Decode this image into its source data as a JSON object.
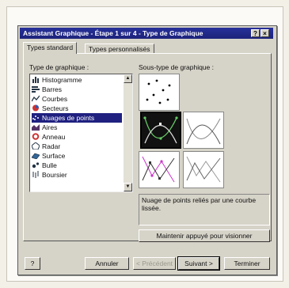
{
  "window": {
    "title": "Assistant Graphique - Étape 1 sur 4 - Type de Graphique",
    "help_glyph": "?",
    "close_glyph": "×"
  },
  "tabs": [
    {
      "label": "Types standard",
      "active": true
    },
    {
      "label": "Types personnalisés",
      "active": false
    }
  ],
  "chart_type": {
    "label": "Type de graphique :",
    "items": [
      {
        "label": "Histogramme",
        "icon": "bar-chart-icon"
      },
      {
        "label": "Barres",
        "icon": "horizontal-bar-icon"
      },
      {
        "label": "Courbes",
        "icon": "line-chart-icon"
      },
      {
        "label": "Secteurs",
        "icon": "pie-chart-icon"
      },
      {
        "label": "Nuages de points",
        "icon": "scatter-chart-icon",
        "selected": true
      },
      {
        "label": "Aires",
        "icon": "area-chart-icon"
      },
      {
        "label": "Anneau",
        "icon": "donut-chart-icon"
      },
      {
        "label": "Radar",
        "icon": "radar-chart-icon"
      },
      {
        "label": "Surface",
        "icon": "surface-chart-icon"
      },
      {
        "label": "Bulle",
        "icon": "bubble-chart-icon"
      },
      {
        "label": "Boursier",
        "icon": "stock-chart-icon"
      }
    ]
  },
  "subtype": {
    "label": "Sous-type de graphique :",
    "selected_index": 1,
    "description": "Nuage de points reliés par une courbe lissée."
  },
  "buttons": {
    "preview": "Maintenir appuyé pour visionner",
    "help": "?",
    "cancel": "Annuler",
    "previous": "< Précédent",
    "next": "Suivant >",
    "finish": "Terminer"
  },
  "colors": {
    "titlebar": "#1c237a",
    "selection": "#1f2080",
    "dialog": "#d6d3c8"
  }
}
